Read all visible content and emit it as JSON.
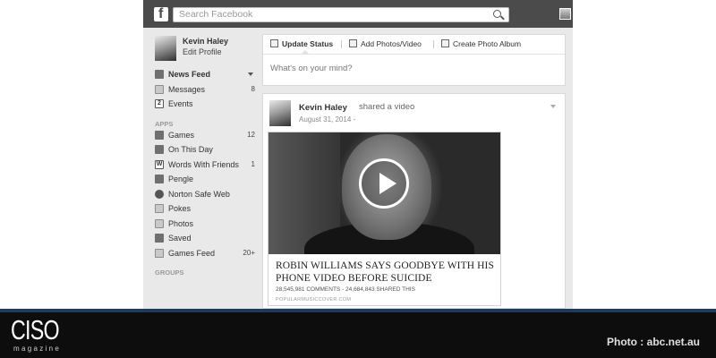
{
  "header": {
    "logo_letter": "f",
    "search_placeholder": "Search Facebook"
  },
  "sidebar": {
    "profile_name": "Kevin Haley",
    "edit_profile": "Edit Profile",
    "items": [
      {
        "label": "News Feed",
        "count": ""
      },
      {
        "label": "Messages",
        "count": "8"
      },
      {
        "label": "Events",
        "count": ""
      }
    ],
    "events_icon_text": "2",
    "apps_label": "APPS",
    "apps": [
      {
        "label": "Games",
        "count": "12"
      },
      {
        "label": "On This Day",
        "count": ""
      },
      {
        "label": "Words With Friends",
        "count": "1"
      },
      {
        "label": "Pengle",
        "count": ""
      },
      {
        "label": "Norton Safe Web",
        "count": ""
      },
      {
        "label": "Pokes",
        "count": ""
      },
      {
        "label": "Photos",
        "count": ""
      },
      {
        "label": "Saved",
        "count": ""
      },
      {
        "label": "Games Feed",
        "count": "20+"
      }
    ],
    "words_icon_text": "W",
    "groups_label": "GROUPS"
  },
  "composer": {
    "tabs": [
      "Update Status",
      "Add Photos/Video",
      "Create Photo Album"
    ],
    "placeholder": "What's on your mind?"
  },
  "post": {
    "author": "Kevin Haley",
    "action": "shared a video",
    "date": "August 31, 2014 -",
    "video": {
      "title": "ROBIN WILLIAMS SAYS GOODBYE WITH HIS PHONE VIDEO BEFORE SUICIDE",
      "stats": "28,545,981 COMMENTS - 24,684,843 SHARED THIS",
      "source": "POPULARMUSICCOVER.COM"
    }
  },
  "footer": {
    "brand": "CISO",
    "brand_sub": "magazine",
    "credit": "Photo : abc.net.au",
    "accent": "#1f3b5c"
  }
}
